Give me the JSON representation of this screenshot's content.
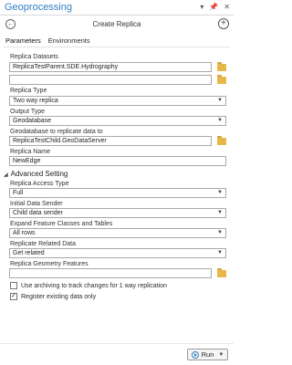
{
  "window": {
    "title": "Geoprocessing",
    "pin_icon": "pin-icon",
    "close_icon": "close-icon",
    "menu_icon": "menu-icon"
  },
  "tool": {
    "title": "Create Replica",
    "back_icon": "back-icon",
    "add_icon": "add-icon"
  },
  "tabs": [
    {
      "label": "Parameters"
    },
    {
      "label": "Environments"
    }
  ],
  "params": {
    "replica_datasets_label": "Replica Datasets",
    "replica_datasets_value": "ReplicaTestParent.SDE.Hydrography",
    "replica_datasets_empty": "",
    "replica_type_label": "Replica Type",
    "replica_type_value": "Two way replica",
    "output_type_label": "Output Type",
    "output_type_value": "Geodatabase",
    "gdb_label": "Geodatabase to replicate data to",
    "gdb_value": "ReplicaTestChild.GeoDataServer",
    "replica_name_label": "Replica Name",
    "replica_name_value": "NewEdge"
  },
  "advanced": {
    "section_label": "Advanced Setting",
    "access_type_label": "Replica Access Type",
    "access_type_value": "Full",
    "initial_sender_label": "Initial Data Sender",
    "initial_sender_value": "Child data sender",
    "expand_label": "Expand Feature Classes and Tables",
    "expand_value": "All rows",
    "related_label": "Replicate Related Data",
    "related_value": "Get related",
    "geometry_label": "Replica Geometry Features",
    "geometry_value": "",
    "archiving_label": "Use archiving to track changes for 1 way replication",
    "archiving_checked": false,
    "register_label": "Register existing data only",
    "register_checked": true
  },
  "footer": {
    "run_label": "Run"
  },
  "colors": {
    "accent": "#2f7fc6",
    "folder": "#e8b74a"
  }
}
